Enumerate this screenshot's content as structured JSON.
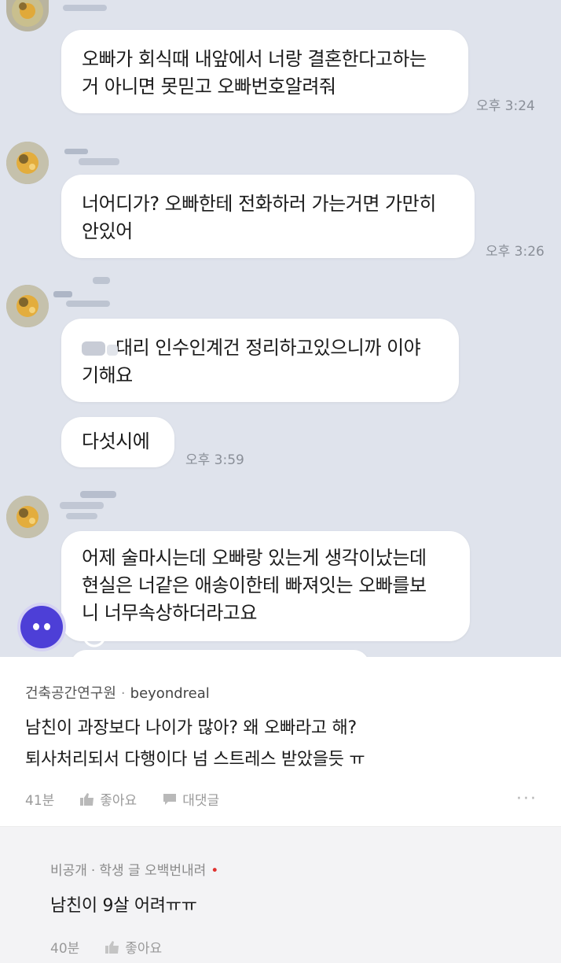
{
  "chat": {
    "messages": [
      {
        "lines": [
          "오빠가 회식때 내앞에서 너랑 결혼한다고하는",
          "거 아니면 못믿고 오빠번호알려줘"
        ],
        "time": "오후 3:24"
      },
      {
        "lines": [
          "너어디가? 오빠한테 전화하러 가는거면 가만히",
          "안있어"
        ],
        "time": "오후 3:26"
      },
      {
        "lines": [
          "대리 인수인계건 정리하고있으니까 이야",
          "기해요"
        ],
        "time": ""
      },
      {
        "lines": [
          "다섯시에"
        ],
        "time": "오후 3:59"
      },
      {
        "lines": [
          "어제 술마시는데 오빠랑 있는게 생각이났는데",
          "현실은 너같은 애송이한테 빠져잇는 오빠를보",
          "니 너무속상하더라고요"
        ],
        "time": ""
      }
    ]
  },
  "comments": [
    {
      "author": "건축공간연구원",
      "username": "beyondreal",
      "lines": [
        "남친이 과장보다 나이가 많아? 왜 오빠라고 해?",
        "퇴사처리되서 다행이다 넘 스트레스 받았을듯 ㅠ"
      ],
      "age": "41분",
      "like_label": "좋아요",
      "reply_label": "대댓글",
      "more": "···"
    },
    {
      "author": "비공개",
      "username": "학생 글 오백번내려",
      "text": "남친이 9살 어려ㅠㅠ",
      "age": "40분",
      "like_label": "좋아요"
    }
  ],
  "colors": {
    "chat_bg": "#dfe3ec",
    "bubble": "#ffffff",
    "bot_avatar": "#4d3fd7",
    "reply_bg": "#f3f3f5",
    "op_dot": "#e0322f"
  }
}
